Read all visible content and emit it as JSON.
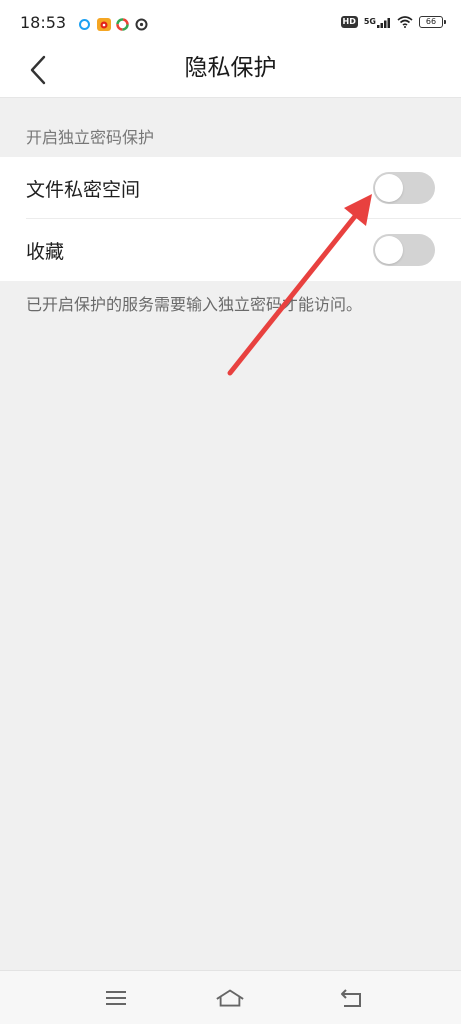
{
  "status_bar": {
    "time": "18:53",
    "hd": "HD",
    "network": "5G",
    "battery": "66"
  },
  "header": {
    "title": "隐私保护"
  },
  "section": {
    "label": "开启独立密码保护"
  },
  "settings": [
    {
      "label": "文件私密空间",
      "enabled": false
    },
    {
      "label": "收藏",
      "enabled": false
    }
  ],
  "hint": "已开启保护的服务需要输入独立密码才能访问。",
  "colors": {
    "annotation_arrow": "#e8413f",
    "toggle_off": "#d3d3d3",
    "background": "#f0f0f0"
  },
  "icons": {
    "back": "chevron-left-icon",
    "menu": "menu-icon",
    "home": "home-icon",
    "return": "return-icon"
  }
}
